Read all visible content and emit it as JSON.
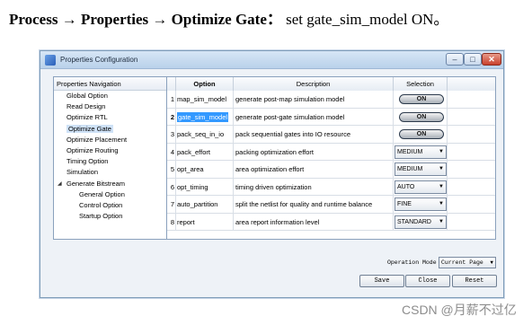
{
  "caption": {
    "path": "Process → Properties → Optimize Gate：",
    "instruction": "set gate_sim_model ON。"
  },
  "window": {
    "title": "Properties Configuration",
    "controls": {
      "minimize": "–",
      "maximize": "□",
      "close": "✕"
    }
  },
  "nav": {
    "header": "Properties Navigation",
    "items": [
      {
        "label": "Global Option"
      },
      {
        "label": "Read Design"
      },
      {
        "label": "Optimize RTL"
      },
      {
        "label": "Optimize Gate"
      },
      {
        "label": "Optimize Placement"
      },
      {
        "label": "Optimize Routing"
      },
      {
        "label": "Timing Option"
      },
      {
        "label": "Simulation"
      },
      {
        "label": "Generate Bitstream"
      },
      {
        "label": "General Option"
      },
      {
        "label": "Control Option"
      },
      {
        "label": "Startup Option"
      }
    ],
    "selected": "Optimize Gate"
  },
  "grid": {
    "columns": {
      "option": "Option",
      "description": "Description",
      "selection": "Selection"
    },
    "rows": [
      {
        "num": "1",
        "option": "map_sim_model",
        "description": "generate post-map simulation model",
        "selection": "ON",
        "kind": "toggle"
      },
      {
        "num": "2",
        "option": "gate_sim_model",
        "description": "generate post-gate simulation model",
        "selection": "ON",
        "kind": "toggle"
      },
      {
        "num": "3",
        "option": "pack_seq_in_io",
        "description": "pack sequential gates into IO resource",
        "selection": "ON",
        "kind": "toggle"
      },
      {
        "num": "4",
        "option": "pack_effort",
        "description": "packing optimization effort",
        "selection": "MEDIUM",
        "kind": "select"
      },
      {
        "num": "5",
        "option": "opt_area",
        "description": "area optimization effort",
        "selection": "MEDIUM",
        "kind": "select"
      },
      {
        "num": "6",
        "option": "opt_timing",
        "description": "timing driven optimization",
        "selection": "AUTO",
        "kind": "select"
      },
      {
        "num": "7",
        "option": "auto_partition",
        "description": "split the netlist for quality and runtime balance",
        "selection": "FINE",
        "kind": "select"
      },
      {
        "num": "8",
        "option": "report",
        "description": "area report information level",
        "selection": "STANDARD",
        "kind": "select"
      }
    ],
    "selected_row": "2"
  },
  "footer": {
    "operation_mode_label": "Operation Mode",
    "operation_mode_value": "Current Page",
    "save_label": "Save",
    "close_label": "Close",
    "reset_label": "Reset"
  },
  "watermark": "CSDN @月薪不过亿"
}
